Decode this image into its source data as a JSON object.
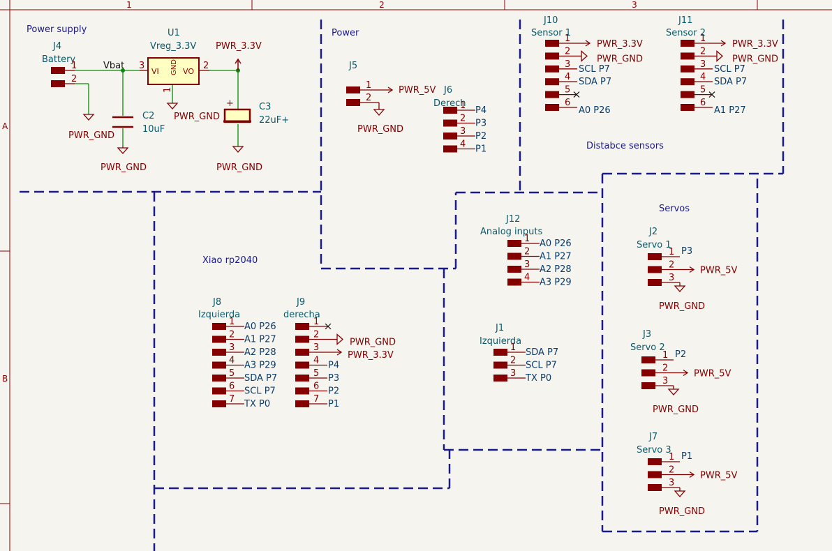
{
  "frame": {
    "columns": [
      "1",
      "2",
      "3"
    ],
    "rows": [
      "A",
      "B"
    ]
  },
  "notes": {
    "power_supply": "Power supply",
    "power": "Power",
    "distance": "Distabce sensors",
    "xiao": "Xiao rp2040",
    "servos": "Servos"
  },
  "power_supply": {
    "j4_ref": "J4",
    "j4_value": "Battery",
    "j4_pin1": "1",
    "j4_pin2": "2",
    "vbat": "Vbat",
    "u1_ref": "U1",
    "u1_value": "Vreg_3.3V",
    "u1_vi": "VI",
    "u1_vo": "VO",
    "u1_gnd": "GND",
    "u1_pin3": "3",
    "u1_pin2": "2",
    "u1_pin1": "1",
    "c2_ref": "C2",
    "c2_value": "10uF",
    "c3_ref": "C3",
    "c3_value": "22uF+",
    "pwr33": "PWR_3.3V",
    "gnd_bat": "PWR_GND",
    "gnd_c2": "PWR_GND",
    "gnd_u1": "PWR_GND",
    "gnd_c3": "PWR_GND"
  },
  "power_header": {
    "j5_ref": "J5",
    "pin1": "1",
    "pin2": "2",
    "pwr5v": "PWR_5V",
    "gnd": "PWR_GND",
    "j6_ref": "J6",
    "j6_value": "Derech",
    "j6_pins": [
      {
        "num": "1",
        "label": "P4"
      },
      {
        "num": "2",
        "label": "P3"
      },
      {
        "num": "3",
        "label": "P2"
      },
      {
        "num": "4",
        "label": "P1"
      }
    ]
  },
  "sensors": {
    "j10_ref": "J10",
    "j10_value": "Sensor 1",
    "j10_pins": [
      {
        "num": "1",
        "label": "PWR_3.3V"
      },
      {
        "num": "2",
        "label": "PWR_GND"
      },
      {
        "num": "3",
        "label": "SCL P7"
      },
      {
        "num": "4",
        "label": "SDA P7"
      },
      {
        "num": "5",
        "label": ""
      },
      {
        "num": "6",
        "label": "A0 P26"
      }
    ],
    "j11_ref": "J11",
    "j11_value": "Sensor 2",
    "j11_pins": [
      {
        "num": "1",
        "label": "PWR_3.3V"
      },
      {
        "num": "2",
        "label": "PWR_GND"
      },
      {
        "num": "3",
        "label": "SCL P7"
      },
      {
        "num": "4",
        "label": "SDA P7"
      },
      {
        "num": "5",
        "label": ""
      },
      {
        "num": "6",
        "label": "A1 P27"
      }
    ]
  },
  "xiao": {
    "j8_ref": "J8",
    "j8_value": "Izquierda",
    "j8_pins": [
      {
        "num": "1",
        "label": "A0 P26"
      },
      {
        "num": "2",
        "label": "A1 P27"
      },
      {
        "num": "3",
        "label": "A2 P28"
      },
      {
        "num": "4",
        "label": "A3 P29"
      },
      {
        "num": "5",
        "label": "SDA P7"
      },
      {
        "num": "6",
        "label": "SCL P7"
      },
      {
        "num": "7",
        "label": "TX P0"
      }
    ],
    "j9_ref": "J9",
    "j9_value": "derecha",
    "j9_pins": [
      {
        "num": "1",
        "label": ""
      },
      {
        "num": "2",
        "label": "PWR_GND"
      },
      {
        "num": "3",
        "label": "PWR_3.3V"
      },
      {
        "num": "4",
        "label": "P4"
      },
      {
        "num": "5",
        "label": "P3"
      },
      {
        "num": "6",
        "label": "P2"
      },
      {
        "num": "7",
        "label": "P1"
      }
    ]
  },
  "analog": {
    "j12_ref": "J12",
    "j12_value": "Analog inputs",
    "j12_pins": [
      {
        "num": "1",
        "label": "A0 P26"
      },
      {
        "num": "2",
        "label": "A1 P27"
      },
      {
        "num": "3",
        "label": "A2 P28"
      },
      {
        "num": "4",
        "label": "A3 P29"
      }
    ],
    "j1_ref": "J1",
    "j1_value": "Izquierda",
    "j1_pins": [
      {
        "num": "1",
        "label": "SDA P7"
      },
      {
        "num": "2",
        "label": "SCL P7"
      },
      {
        "num": "3",
        "label": "TX P0"
      }
    ]
  },
  "servos": {
    "items": [
      {
        "ref": "J2",
        "value": "Servo 1",
        "p1": "P3",
        "pwr": "PWR_5V",
        "gnd": "PWR_GND",
        "n1": "1",
        "n2": "2",
        "n3": "3"
      },
      {
        "ref": "J3",
        "value": "Servo 2",
        "p1": "P2",
        "pwr": "PWR_5V",
        "gnd": "PWR_GND",
        "n1": "1",
        "n2": "2",
        "n3": "3"
      },
      {
        "ref": "J7",
        "value": "Servo 3",
        "p1": "P1",
        "pwr": "PWR_5V",
        "gnd": "PWR_GND",
        "n1": "1",
        "n2": "2",
        "n3": "3"
      }
    ]
  },
  "colors": {
    "background": "#f5f4ef",
    "wire": "#0a8a0a",
    "symbol": "#840000",
    "frame": "#8a0000",
    "dash": "#1a1a8a",
    "reference": "#0a5a6a"
  }
}
